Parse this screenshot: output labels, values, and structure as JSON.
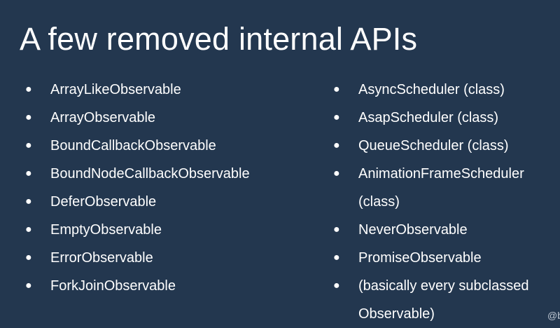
{
  "slide": {
    "title": "A few removed internal APIs",
    "left_items": [
      "ArrayLikeObservable",
      "ArrayObservable",
      "BoundCallbackObservable",
      "BoundNodeCallbackObservable",
      "DeferObservable",
      "EmptyObservable",
      "ErrorObservable",
      "ForkJoinObservable"
    ],
    "right_items": [
      "AsyncScheduler (class)",
      "AsapScheduler (class)",
      "QueueScheduler (class)",
      "AnimationFrameScheduler (class)",
      "NeverObservable",
      "PromiseObservable",
      "(basically every subclassed Observable)"
    ],
    "bullet_char": "●",
    "credit": "@b"
  },
  "colors": {
    "background": "#23374f",
    "text": "#ffffff"
  }
}
